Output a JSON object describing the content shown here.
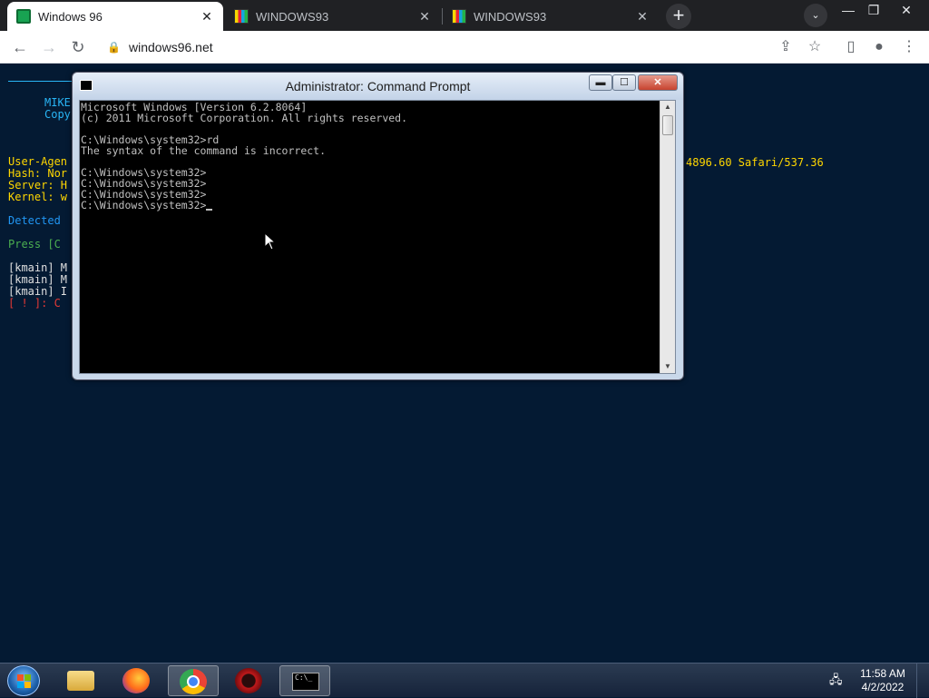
{
  "browser": {
    "tabs": [
      {
        "title": "Windows 96",
        "icon": "windows96-favicon",
        "active": true
      },
      {
        "title": "WINDOWS93",
        "icon": "windows93-favicon",
        "active": false
      },
      {
        "title": "WINDOWS93",
        "icon": "windows93-favicon",
        "active": false
      }
    ],
    "tab_close_glyph": "✕",
    "new_tab_glyph": "+",
    "tab_search_glyph": "⌄",
    "window_controls": {
      "minimize": "—",
      "restore": "❐",
      "close": "✕"
    },
    "url": "windows96.net",
    "nav": {
      "back": "←",
      "forward": "→",
      "reload": "↻"
    },
    "toolbar_icons": {
      "share": "⇪",
      "bookmark": "☆",
      "sidepanel": "▯",
      "profile": "●",
      "menu": "⋮"
    }
  },
  "page": {
    "header_lines": [
      {
        "text": "MIKE",
        "color": "#29b6f6"
      },
      {
        "text": "Copy",
        "color": "#29b6f6"
      }
    ],
    "info_lines": [
      {
        "text": "User-Agen",
        "color": "#ffd700"
      },
      {
        "text": "Hash: Nor",
        "color": "#ffd700"
      },
      {
        "text": "Server: H",
        "color": "#ffd700"
      },
      {
        "text": "Kernel: w",
        "color": "#ffd700"
      }
    ],
    "user_agent_tail": "4896.60 Safari/537.36",
    "detected": "Detected",
    "press": "Press [C",
    "kmain_lines": [
      "[kmain] M",
      "[kmain] M",
      "[kmain] I"
    ],
    "error_line": "[ ! ]: C"
  },
  "cmd_window": {
    "title": "Administrator: Command Prompt",
    "controls": {
      "minimize": "▬",
      "maximize": "☐",
      "close": "✕"
    },
    "output_lines": [
      "Microsoft Windows [Version 6.2.8064]",
      "(c) 2011 Microsoft Corporation. All rights reserved.",
      "",
      "C:\\Windows\\system32>rd",
      "The syntax of the command is incorrect.",
      "",
      "C:\\Windows\\system32>",
      "C:\\Windows\\system32>",
      "C:\\Windows\\system32>",
      "C:\\Windows\\system32>"
    ],
    "scroll_up": "▲",
    "scroll_down": "▼"
  },
  "taskbar": {
    "apps": [
      {
        "name": "file-explorer",
        "active": false
      },
      {
        "name": "firefox",
        "active": false
      },
      {
        "name": "chrome",
        "active": true
      },
      {
        "name": "virus-app",
        "active": false
      },
      {
        "name": "command-prompt",
        "active": true
      }
    ],
    "cmd_icon_text": "C:\\_",
    "tray": {
      "time": "11:58 AM",
      "date": "4/2/2022",
      "network_glyph": "🖧"
    }
  },
  "colors": {
    "page_background": "#041a33",
    "cmd_text": "#c0c0c0",
    "detected_color": "#2196f3",
    "press_color": "#4caf50",
    "error_color": "#e53935",
    "kmain_color": "#e0e0e0"
  }
}
